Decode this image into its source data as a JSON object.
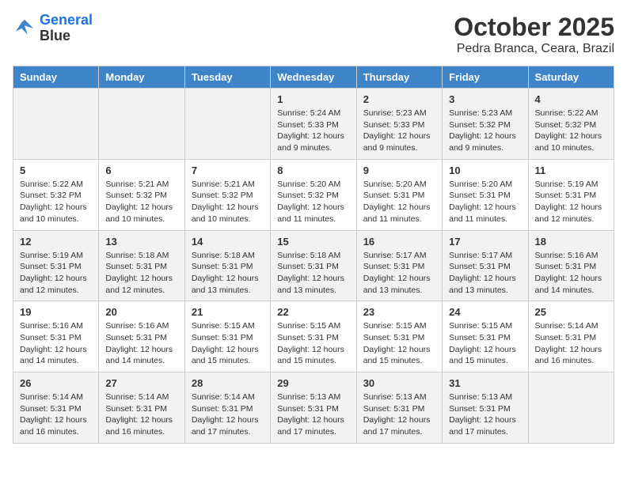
{
  "logo": {
    "line1": "General",
    "line2": "Blue"
  },
  "title": "October 2025",
  "location": "Pedra Branca, Ceara, Brazil",
  "weekdays": [
    "Sunday",
    "Monday",
    "Tuesday",
    "Wednesday",
    "Thursday",
    "Friday",
    "Saturday"
  ],
  "weeks": [
    [
      {
        "day": "",
        "info": ""
      },
      {
        "day": "",
        "info": ""
      },
      {
        "day": "",
        "info": ""
      },
      {
        "day": "1",
        "info": "Sunrise: 5:24 AM\nSunset: 5:33 PM\nDaylight: 12 hours and 9 minutes."
      },
      {
        "day": "2",
        "info": "Sunrise: 5:23 AM\nSunset: 5:33 PM\nDaylight: 12 hours and 9 minutes."
      },
      {
        "day": "3",
        "info": "Sunrise: 5:23 AM\nSunset: 5:32 PM\nDaylight: 12 hours and 9 minutes."
      },
      {
        "day": "4",
        "info": "Sunrise: 5:22 AM\nSunset: 5:32 PM\nDaylight: 12 hours and 10 minutes."
      }
    ],
    [
      {
        "day": "5",
        "info": "Sunrise: 5:22 AM\nSunset: 5:32 PM\nDaylight: 12 hours and 10 minutes."
      },
      {
        "day": "6",
        "info": "Sunrise: 5:21 AM\nSunset: 5:32 PM\nDaylight: 12 hours and 10 minutes."
      },
      {
        "day": "7",
        "info": "Sunrise: 5:21 AM\nSunset: 5:32 PM\nDaylight: 12 hours and 10 minutes."
      },
      {
        "day": "8",
        "info": "Sunrise: 5:20 AM\nSunset: 5:32 PM\nDaylight: 12 hours and 11 minutes."
      },
      {
        "day": "9",
        "info": "Sunrise: 5:20 AM\nSunset: 5:31 PM\nDaylight: 12 hours and 11 minutes."
      },
      {
        "day": "10",
        "info": "Sunrise: 5:20 AM\nSunset: 5:31 PM\nDaylight: 12 hours and 11 minutes."
      },
      {
        "day": "11",
        "info": "Sunrise: 5:19 AM\nSunset: 5:31 PM\nDaylight: 12 hours and 12 minutes."
      }
    ],
    [
      {
        "day": "12",
        "info": "Sunrise: 5:19 AM\nSunset: 5:31 PM\nDaylight: 12 hours and 12 minutes."
      },
      {
        "day": "13",
        "info": "Sunrise: 5:18 AM\nSunset: 5:31 PM\nDaylight: 12 hours and 12 minutes."
      },
      {
        "day": "14",
        "info": "Sunrise: 5:18 AM\nSunset: 5:31 PM\nDaylight: 12 hours and 13 minutes."
      },
      {
        "day": "15",
        "info": "Sunrise: 5:18 AM\nSunset: 5:31 PM\nDaylight: 12 hours and 13 minutes."
      },
      {
        "day": "16",
        "info": "Sunrise: 5:17 AM\nSunset: 5:31 PM\nDaylight: 12 hours and 13 minutes."
      },
      {
        "day": "17",
        "info": "Sunrise: 5:17 AM\nSunset: 5:31 PM\nDaylight: 12 hours and 13 minutes."
      },
      {
        "day": "18",
        "info": "Sunrise: 5:16 AM\nSunset: 5:31 PM\nDaylight: 12 hours and 14 minutes."
      }
    ],
    [
      {
        "day": "19",
        "info": "Sunrise: 5:16 AM\nSunset: 5:31 PM\nDaylight: 12 hours and 14 minutes."
      },
      {
        "day": "20",
        "info": "Sunrise: 5:16 AM\nSunset: 5:31 PM\nDaylight: 12 hours and 14 minutes."
      },
      {
        "day": "21",
        "info": "Sunrise: 5:15 AM\nSunset: 5:31 PM\nDaylight: 12 hours and 15 minutes."
      },
      {
        "day": "22",
        "info": "Sunrise: 5:15 AM\nSunset: 5:31 PM\nDaylight: 12 hours and 15 minutes."
      },
      {
        "day": "23",
        "info": "Sunrise: 5:15 AM\nSunset: 5:31 PM\nDaylight: 12 hours and 15 minutes."
      },
      {
        "day": "24",
        "info": "Sunrise: 5:15 AM\nSunset: 5:31 PM\nDaylight: 12 hours and 15 minutes."
      },
      {
        "day": "25",
        "info": "Sunrise: 5:14 AM\nSunset: 5:31 PM\nDaylight: 12 hours and 16 minutes."
      }
    ],
    [
      {
        "day": "26",
        "info": "Sunrise: 5:14 AM\nSunset: 5:31 PM\nDaylight: 12 hours and 16 minutes."
      },
      {
        "day": "27",
        "info": "Sunrise: 5:14 AM\nSunset: 5:31 PM\nDaylight: 12 hours and 16 minutes."
      },
      {
        "day": "28",
        "info": "Sunrise: 5:14 AM\nSunset: 5:31 PM\nDaylight: 12 hours and 17 minutes."
      },
      {
        "day": "29",
        "info": "Sunrise: 5:13 AM\nSunset: 5:31 PM\nDaylight: 12 hours and 17 minutes."
      },
      {
        "day": "30",
        "info": "Sunrise: 5:13 AM\nSunset: 5:31 PM\nDaylight: 12 hours and 17 minutes."
      },
      {
        "day": "31",
        "info": "Sunrise: 5:13 AM\nSunset: 5:31 PM\nDaylight: 12 hours and 17 minutes."
      },
      {
        "day": "",
        "info": ""
      }
    ]
  ]
}
